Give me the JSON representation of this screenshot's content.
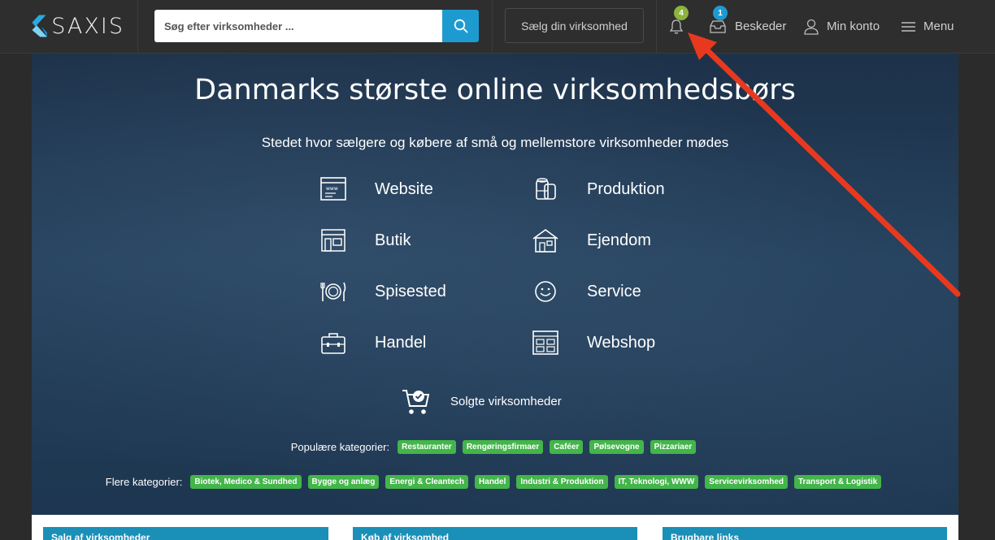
{
  "header": {
    "logo_text": "SAXIS",
    "search_placeholder": "Søg efter virksomheder ...",
    "sell_label": "Sælg din virksomhed",
    "notifications_count": "4",
    "messages_count": "1",
    "messages_label": "Beskeder",
    "account_label": "Min konto",
    "menu_label": "Menu"
  },
  "hero": {
    "title": "Danmarks største online virksomhedsbørs",
    "subtitle": "Stedet hvor sælgere og købere af små og mellemstore virksomheder mødes",
    "categories": [
      {
        "label": "Website",
        "icon": "website-icon"
      },
      {
        "label": "Produktion",
        "icon": "production-icon"
      },
      {
        "label": "Butik",
        "icon": "shop-icon"
      },
      {
        "label": "Ejendom",
        "icon": "property-icon"
      },
      {
        "label": "Spisested",
        "icon": "dining-icon"
      },
      {
        "label": "Service",
        "icon": "service-icon"
      },
      {
        "label": "Handel",
        "icon": "briefcase-icon"
      },
      {
        "label": "Webshop",
        "icon": "webshop-icon"
      }
    ],
    "sold_label": "Solgte virksomheder",
    "popular_label": "Populære kategorier:",
    "popular_tags": [
      "Restauranter",
      "Rengøringsfirmaer",
      "Caféer",
      "Pølsevogne",
      "Pizzariaer"
    ],
    "more_label": "Flere kategorier:",
    "more_tags": [
      "Biotek, Medico & Sundhed",
      "Bygge og anlæg",
      "Energi & Cleantech",
      "Handel",
      "Industri & Produktion",
      "IT, Teknologi, WWW",
      "Servicevirksomhed",
      "Transport & Logistik"
    ]
  },
  "cards": [
    {
      "title": "Salg af virksomheder"
    },
    {
      "title": "Køb af virksomhed"
    },
    {
      "title": "Brugbare links"
    }
  ],
  "colors": {
    "accent": "#1d9bd1",
    "tag_green": "#43b54a",
    "badge_green": "#8cb33f",
    "badge_blue": "#1d9bd1",
    "annotation_red": "#e8391f"
  }
}
